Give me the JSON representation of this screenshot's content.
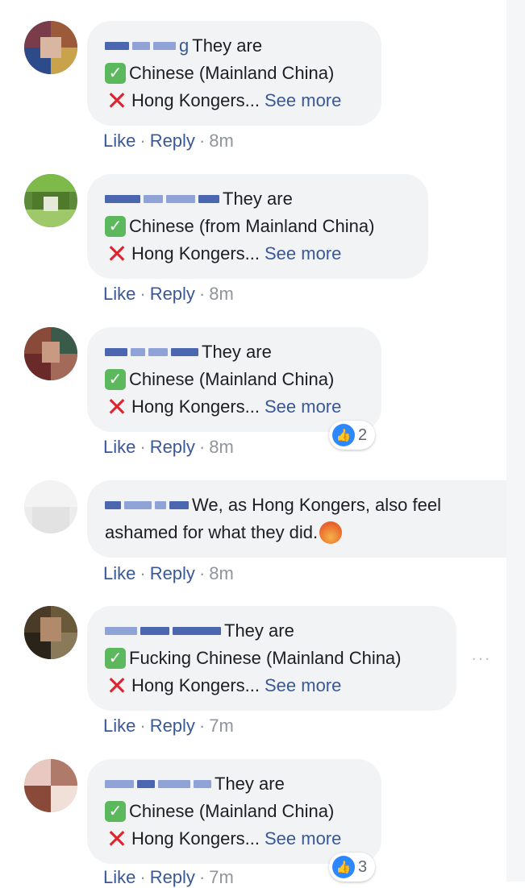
{
  "comments": [
    {
      "author_tail": "g",
      "lines": [
        "They are",
        "Chinese (Mainland China)",
        "Hong Kongers..."
      ],
      "see_more": "See more",
      "actions": {
        "like": "Like",
        "reply": "Reply",
        "time": "8m"
      }
    },
    {
      "author_tail": "",
      "lines": [
        "They are",
        "Chinese (from Mainland China)",
        "Hong Kongers..."
      ],
      "see_more": "See more",
      "actions": {
        "like": "Like",
        "reply": "Reply",
        "time": "8m"
      }
    },
    {
      "author_tail": "",
      "lines": [
        "They are",
        "Chinese (Mainland China)",
        "Hong Kongers..."
      ],
      "see_more": "See more",
      "actions": {
        "like": "Like",
        "reply": "Reply",
        "time": "8m"
      },
      "reactions": "2"
    },
    {
      "author_tail": "",
      "lines": [
        "We, as Hong Kongers, also feel",
        "ashamed for what they did."
      ],
      "actions": {
        "like": "Like",
        "reply": "Reply",
        "time": "8m"
      }
    },
    {
      "author_tail": "",
      "lines": [
        "They are",
        "Fucking Chinese (Mainland China)",
        "Hong Kongers..."
      ],
      "see_more": "See more",
      "actions": {
        "like": "Like",
        "reply": "Reply",
        "time": "7m"
      },
      "more_options": "···"
    },
    {
      "author_tail": "",
      "lines": [
        "They are",
        "Chinese (Mainland China)",
        "Hong Kongers..."
      ],
      "see_more": "See more",
      "actions": {
        "like": "Like",
        "reply": "Reply",
        "time": "7m"
      },
      "reactions": "3"
    }
  ],
  "icons": {
    "check": "white-check-mark-in-green-box-icon",
    "cross": "red-cross-mark-icon",
    "like": "like-reaction-icon",
    "angry": "angry-face-emoji-icon"
  },
  "colors": {
    "link": "#385898",
    "muted": "#90949c",
    "bubble": "#f2f3f5",
    "check_green": "#5cb85c",
    "cross_red": "#e0242e",
    "like_blue": "#2d88ff"
  }
}
